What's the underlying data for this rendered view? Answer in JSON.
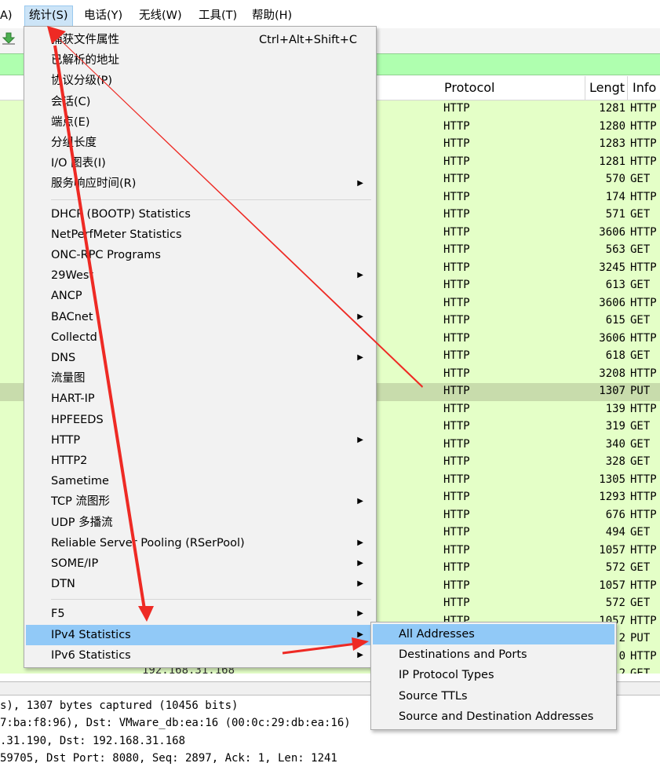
{
  "menubar": [
    {
      "label": "A)"
    },
    {
      "label": "统计(S)"
    },
    {
      "label": "电话(Y)"
    },
    {
      "label": "无线(W)"
    },
    {
      "label": "工具(T)"
    },
    {
      "label": "帮助(H)"
    }
  ],
  "columns": {
    "protocol": "Protocol",
    "length": "Lengt",
    "info": "Info"
  },
  "rows": [
    {
      "protocol": "HTTP",
      "length": "1281",
      "info": "HTTP"
    },
    {
      "protocol": "HTTP",
      "length": "1280",
      "info": "HTTP"
    },
    {
      "protocol": "HTTP",
      "length": "1283",
      "info": "HTTP"
    },
    {
      "protocol": "HTTP",
      "length": "1281",
      "info": "HTTP"
    },
    {
      "protocol": "HTTP",
      "length": "570",
      "info": "GET"
    },
    {
      "protocol": "HTTP",
      "length": "174",
      "info": "HTTP"
    },
    {
      "protocol": "HTTP",
      "length": "571",
      "info": "GET"
    },
    {
      "protocol": "HTTP",
      "length": "3606",
      "info": "HTTP"
    },
    {
      "protocol": "HTTP",
      "length": "563",
      "info": "GET"
    },
    {
      "protocol": "HTTP",
      "length": "3245",
      "info": "HTTP"
    },
    {
      "protocol": "HTTP",
      "length": "613",
      "info": "GET"
    },
    {
      "protocol": "HTTP",
      "length": "3606",
      "info": "HTTP"
    },
    {
      "protocol": "HTTP",
      "length": "615",
      "info": "GET"
    },
    {
      "protocol": "HTTP",
      "length": "3606",
      "info": "HTTP"
    },
    {
      "protocol": "HTTP",
      "length": "618",
      "info": "GET"
    },
    {
      "protocol": "HTTP",
      "length": "3208",
      "info": "HTTP"
    },
    {
      "protocol": "HTTP",
      "length": "1307",
      "info": "PUT",
      "selected": true
    },
    {
      "protocol": "HTTP",
      "length": "139",
      "info": "HTTP"
    },
    {
      "protocol": "HTTP",
      "length": "319",
      "info": "GET"
    },
    {
      "protocol": "HTTP",
      "length": "340",
      "info": "GET"
    },
    {
      "protocol": "HTTP",
      "length": "328",
      "info": "GET"
    },
    {
      "protocol": "HTTP",
      "length": "1305",
      "info": "HTTP"
    },
    {
      "protocol": "HTTP",
      "length": "1293",
      "info": "HTTP"
    },
    {
      "protocol": "HTTP",
      "length": "676",
      "info": "HTTP"
    },
    {
      "protocol": "HTTP",
      "length": "494",
      "info": "GET"
    },
    {
      "protocol": "HTTP",
      "length": "1057",
      "info": "HTTP"
    },
    {
      "protocol": "HTTP",
      "length": "572",
      "info": "GET"
    },
    {
      "protocol": "HTTP",
      "length": "1057",
      "info": "HTTP"
    },
    {
      "protocol": "HTTP",
      "length": "572",
      "info": "GET"
    },
    {
      "protocol": "HTTP",
      "length": "1057",
      "info": "HTTP"
    },
    {
      "protocol": "",
      "length": "2",
      "info": "PUT"
    },
    {
      "protocol": "",
      "length": "0",
      "info": "HTTP"
    },
    {
      "protocol": "",
      "length": "2",
      "info": "GET"
    }
  ],
  "partial_row_source": "192.168.31.168",
  "details": [
    "s), 1307 bytes captured (10456 bits)",
    "7:ba:f8:96), Dst: VMware_db:ea:16 (00:0c:29:db:ea:16)",
    ".31.190, Dst: 192.168.31.168",
    "59705, Dst Port: 8080, Seq: 2897, Ack: 1, Len: 1241"
  ],
  "stats_menu": {
    "items": [
      {
        "label": "捕获文件属性",
        "shortcut": "Ctrl+Alt+Shift+C"
      },
      {
        "label": "已解析的地址"
      },
      {
        "label": "协议分级(P)"
      },
      {
        "label": "会话(C)"
      },
      {
        "label": "端点(E)"
      },
      {
        "label": "分组长度"
      },
      {
        "label": "I/O 图表(I)"
      },
      {
        "label": "服务响应时间(R)",
        "submenu": true
      },
      {
        "sep": true
      },
      {
        "label": "DHCP (BOOTP) Statistics"
      },
      {
        "label": "NetPerfMeter Statistics"
      },
      {
        "label": "ONC-RPC Programs"
      },
      {
        "label": "29West",
        "submenu": true
      },
      {
        "label": "ANCP"
      },
      {
        "label": "BACnet",
        "submenu": true
      },
      {
        "label": "Collectd"
      },
      {
        "label": "DNS",
        "submenu": true
      },
      {
        "label": "流量图"
      },
      {
        "label": "HART-IP"
      },
      {
        "label": "HPFEEDS"
      },
      {
        "label": "HTTP",
        "submenu": true
      },
      {
        "label": "HTTP2"
      },
      {
        "label": "Sametime"
      },
      {
        "label": "TCP 流图形",
        "submenu": true
      },
      {
        "label": "UDP 多播流"
      },
      {
        "label": "Reliable Server Pooling (RSerPool)",
        "submenu": true
      },
      {
        "label": "SOME/IP",
        "submenu": true
      },
      {
        "label": "DTN",
        "submenu": true
      },
      {
        "sep": true
      },
      {
        "label": "F5",
        "submenu": true
      },
      {
        "label": "IPv4 Statistics",
        "submenu": true,
        "highlighted": true
      },
      {
        "label": "IPv6 Statistics",
        "submenu": true
      }
    ]
  },
  "ipv4_submenu": {
    "items": [
      {
        "label": "All Addresses",
        "highlighted": true
      },
      {
        "label": "Destinations and Ports"
      },
      {
        "label": "IP Protocol Types"
      },
      {
        "label": "Source TTLs"
      },
      {
        "label": "Source and Destination Addresses"
      }
    ]
  },
  "colors": {
    "row_bg": "#e4ffc7",
    "row_selected": "#c8dcac",
    "menu_highlight": "#91c9f7",
    "annotation_arrow": "#ee2a24"
  }
}
